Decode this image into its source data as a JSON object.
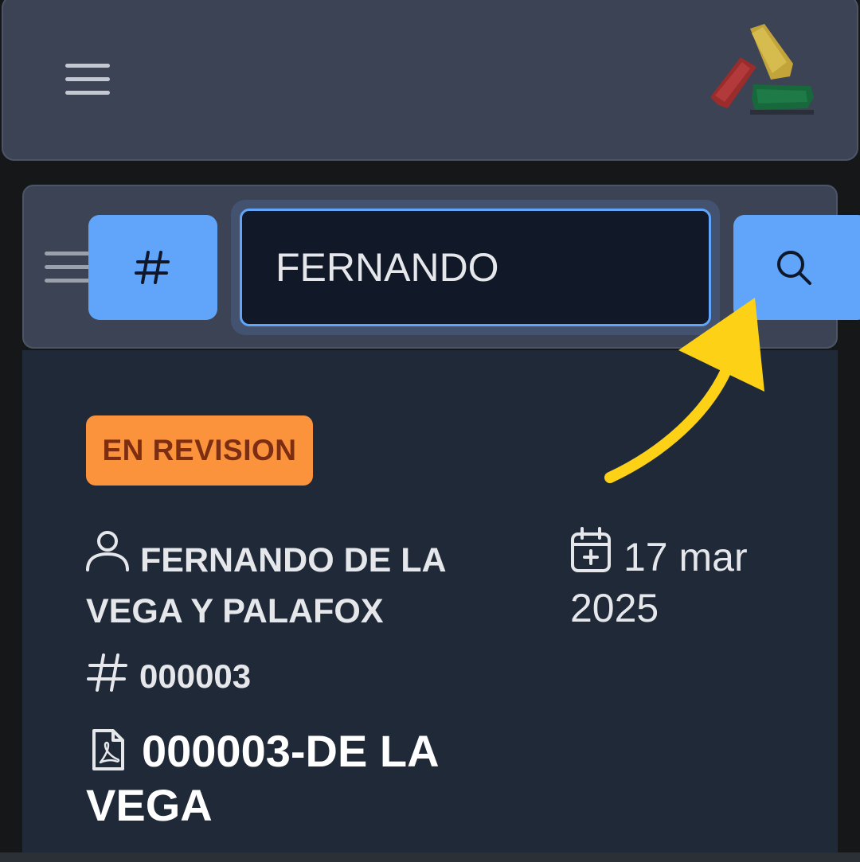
{
  "header": {
    "menu_icon": "hamburger-menu-icon",
    "logo_icon": "brand-logo-brushstrokes",
    "colors": {
      "bar": "#3b4354",
      "logo_red": "#9b2c2c",
      "logo_yellow": "#c2a43a",
      "logo_green": "#17693b"
    }
  },
  "search": {
    "menu_icon": "hamburger-menu-icon",
    "hash_button_label": "#",
    "value": "FERNANDO",
    "search_icon": "search-icon",
    "accent": "#60a5fa"
  },
  "result": {
    "status": "EN REVISION",
    "status_color": "#fb923c",
    "client_name": "FERNANDO DE LA VEGA Y PALAFOX",
    "date": "17 mar 2025",
    "folio": "000003",
    "document_name": "000003-DE LA VEGA",
    "icons": [
      "user-icon",
      "calendar-plus-icon",
      "hash-icon",
      "pdf-file-icon"
    ]
  },
  "annotation": {
    "arrow_color": "#fcd116",
    "arrow_icon": "curved-arrow-icon"
  }
}
